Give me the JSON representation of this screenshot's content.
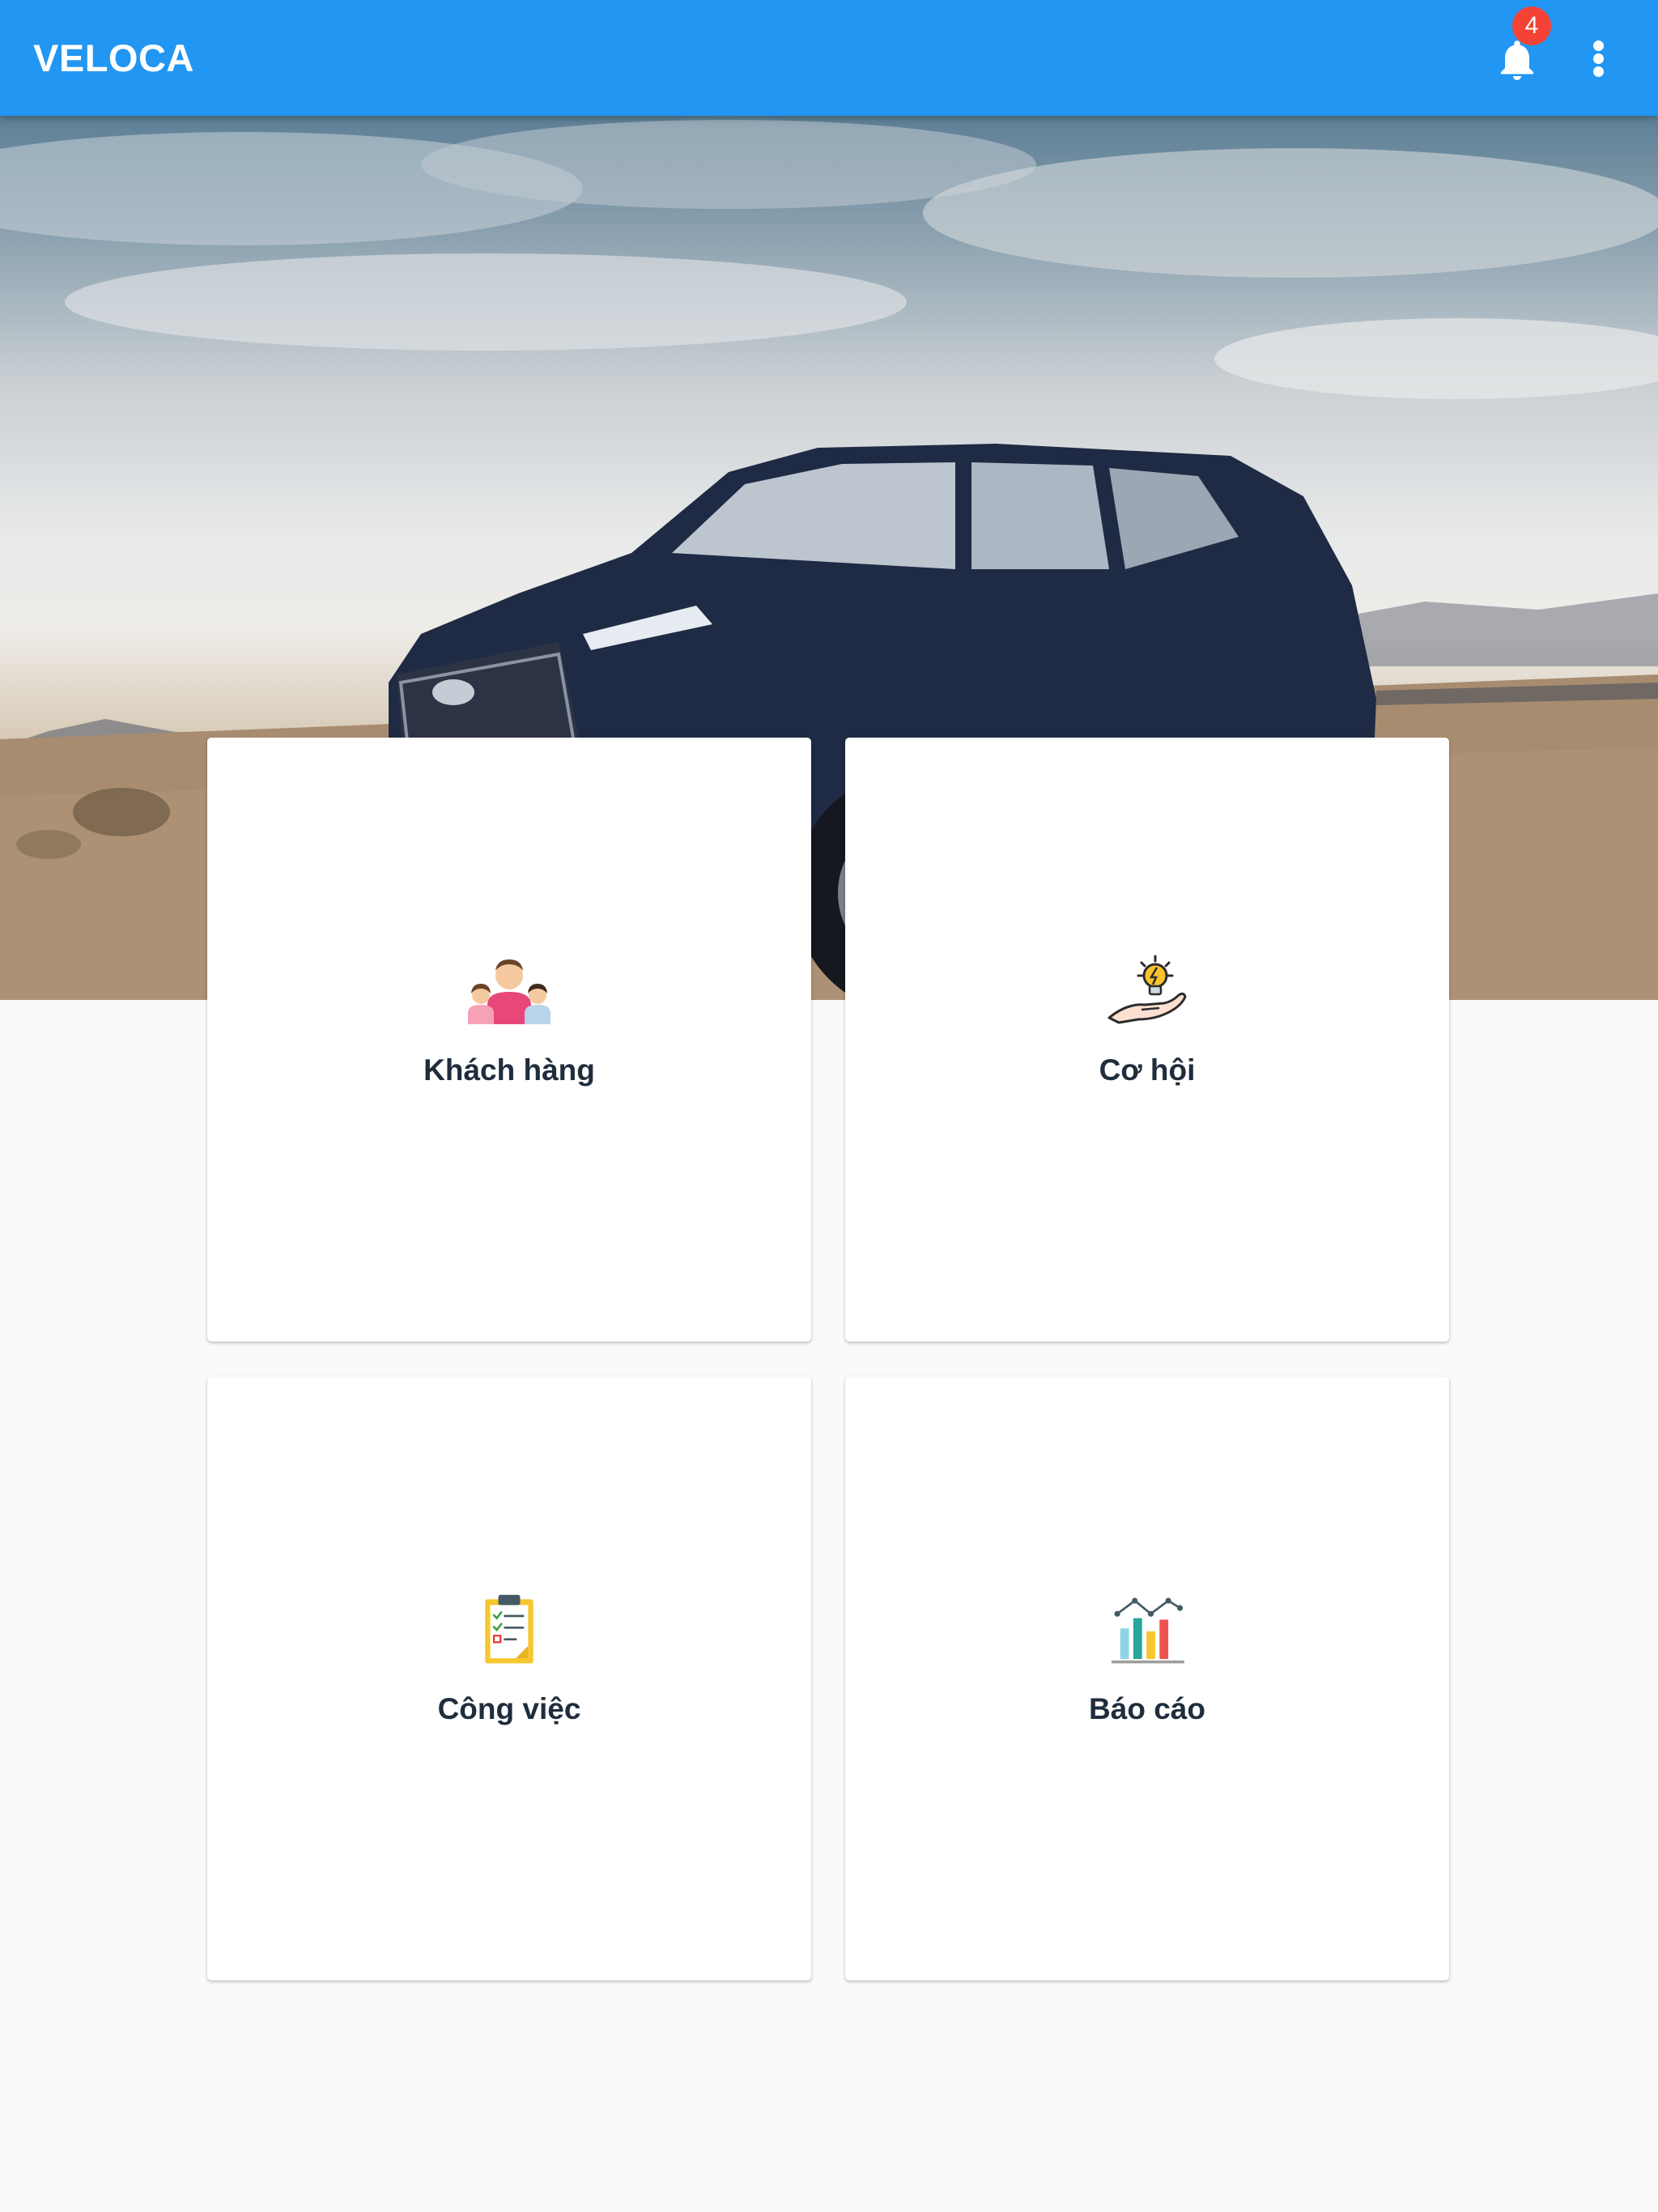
{
  "appbar": {
    "title": "VELOCA",
    "notification_count": "4",
    "color": "#2196f3"
  },
  "hero": {
    "image": "dark-blue-suv-desert-photo"
  },
  "menu": [
    {
      "label": "Khách hàng",
      "icon": "customers-icon"
    },
    {
      "label": "Cơ hội",
      "icon": "opportunity-lightbulb-icon"
    },
    {
      "label": "Công việc",
      "icon": "task-clipboard-icon"
    },
    {
      "label": "Báo cáo",
      "icon": "report-chart-icon"
    }
  ]
}
